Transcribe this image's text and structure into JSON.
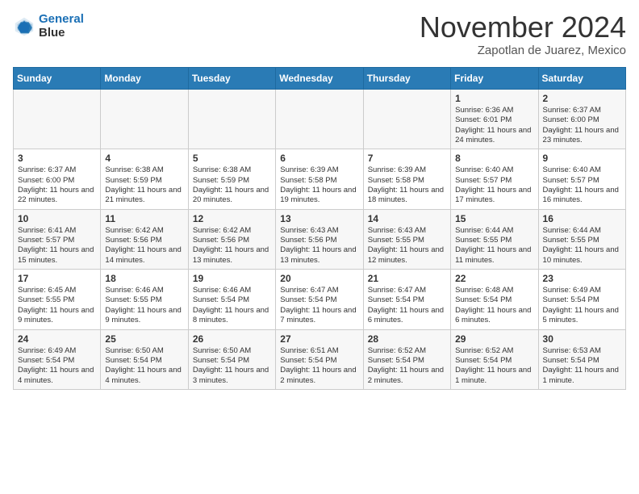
{
  "header": {
    "logo_line1": "General",
    "logo_line2": "Blue",
    "month": "November 2024",
    "location": "Zapotlan de Juarez, Mexico"
  },
  "days_of_week": [
    "Sunday",
    "Monday",
    "Tuesday",
    "Wednesday",
    "Thursday",
    "Friday",
    "Saturday"
  ],
  "weeks": [
    [
      {
        "day": "",
        "info": ""
      },
      {
        "day": "",
        "info": ""
      },
      {
        "day": "",
        "info": ""
      },
      {
        "day": "",
        "info": ""
      },
      {
        "day": "",
        "info": ""
      },
      {
        "day": "1",
        "info": "Sunrise: 6:36 AM\nSunset: 6:01 PM\nDaylight: 11 hours and 24 minutes."
      },
      {
        "day": "2",
        "info": "Sunrise: 6:37 AM\nSunset: 6:00 PM\nDaylight: 11 hours and 23 minutes."
      }
    ],
    [
      {
        "day": "3",
        "info": "Sunrise: 6:37 AM\nSunset: 6:00 PM\nDaylight: 11 hours and 22 minutes."
      },
      {
        "day": "4",
        "info": "Sunrise: 6:38 AM\nSunset: 5:59 PM\nDaylight: 11 hours and 21 minutes."
      },
      {
        "day": "5",
        "info": "Sunrise: 6:38 AM\nSunset: 5:59 PM\nDaylight: 11 hours and 20 minutes."
      },
      {
        "day": "6",
        "info": "Sunrise: 6:39 AM\nSunset: 5:58 PM\nDaylight: 11 hours and 19 minutes."
      },
      {
        "day": "7",
        "info": "Sunrise: 6:39 AM\nSunset: 5:58 PM\nDaylight: 11 hours and 18 minutes."
      },
      {
        "day": "8",
        "info": "Sunrise: 6:40 AM\nSunset: 5:57 PM\nDaylight: 11 hours and 17 minutes."
      },
      {
        "day": "9",
        "info": "Sunrise: 6:40 AM\nSunset: 5:57 PM\nDaylight: 11 hours and 16 minutes."
      }
    ],
    [
      {
        "day": "10",
        "info": "Sunrise: 6:41 AM\nSunset: 5:57 PM\nDaylight: 11 hours and 15 minutes."
      },
      {
        "day": "11",
        "info": "Sunrise: 6:42 AM\nSunset: 5:56 PM\nDaylight: 11 hours and 14 minutes."
      },
      {
        "day": "12",
        "info": "Sunrise: 6:42 AM\nSunset: 5:56 PM\nDaylight: 11 hours and 13 minutes."
      },
      {
        "day": "13",
        "info": "Sunrise: 6:43 AM\nSunset: 5:56 PM\nDaylight: 11 hours and 13 minutes."
      },
      {
        "day": "14",
        "info": "Sunrise: 6:43 AM\nSunset: 5:55 PM\nDaylight: 11 hours and 12 minutes."
      },
      {
        "day": "15",
        "info": "Sunrise: 6:44 AM\nSunset: 5:55 PM\nDaylight: 11 hours and 11 minutes."
      },
      {
        "day": "16",
        "info": "Sunrise: 6:44 AM\nSunset: 5:55 PM\nDaylight: 11 hours and 10 minutes."
      }
    ],
    [
      {
        "day": "17",
        "info": "Sunrise: 6:45 AM\nSunset: 5:55 PM\nDaylight: 11 hours and 9 minutes."
      },
      {
        "day": "18",
        "info": "Sunrise: 6:46 AM\nSunset: 5:55 PM\nDaylight: 11 hours and 9 minutes."
      },
      {
        "day": "19",
        "info": "Sunrise: 6:46 AM\nSunset: 5:54 PM\nDaylight: 11 hours and 8 minutes."
      },
      {
        "day": "20",
        "info": "Sunrise: 6:47 AM\nSunset: 5:54 PM\nDaylight: 11 hours and 7 minutes."
      },
      {
        "day": "21",
        "info": "Sunrise: 6:47 AM\nSunset: 5:54 PM\nDaylight: 11 hours and 6 minutes."
      },
      {
        "day": "22",
        "info": "Sunrise: 6:48 AM\nSunset: 5:54 PM\nDaylight: 11 hours and 6 minutes."
      },
      {
        "day": "23",
        "info": "Sunrise: 6:49 AM\nSunset: 5:54 PM\nDaylight: 11 hours and 5 minutes."
      }
    ],
    [
      {
        "day": "24",
        "info": "Sunrise: 6:49 AM\nSunset: 5:54 PM\nDaylight: 11 hours and 4 minutes."
      },
      {
        "day": "25",
        "info": "Sunrise: 6:50 AM\nSunset: 5:54 PM\nDaylight: 11 hours and 4 minutes."
      },
      {
        "day": "26",
        "info": "Sunrise: 6:50 AM\nSunset: 5:54 PM\nDaylight: 11 hours and 3 minutes."
      },
      {
        "day": "27",
        "info": "Sunrise: 6:51 AM\nSunset: 5:54 PM\nDaylight: 11 hours and 2 minutes."
      },
      {
        "day": "28",
        "info": "Sunrise: 6:52 AM\nSunset: 5:54 PM\nDaylight: 11 hours and 2 minutes."
      },
      {
        "day": "29",
        "info": "Sunrise: 6:52 AM\nSunset: 5:54 PM\nDaylight: 11 hours and 1 minute."
      },
      {
        "day": "30",
        "info": "Sunrise: 6:53 AM\nSunset: 5:54 PM\nDaylight: 11 hours and 1 minute."
      }
    ]
  ]
}
